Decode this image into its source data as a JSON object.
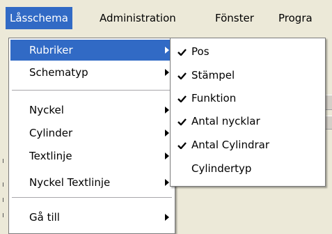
{
  "menubar": {
    "items": [
      {
        "label": "Låsschema"
      },
      {
        "label": "Administration"
      },
      {
        "label": "Fönster"
      },
      {
        "label": "Progra"
      }
    ]
  },
  "main_menu": {
    "items": [
      {
        "label": "Rubriker",
        "has_submenu": true,
        "highlighted": true
      },
      {
        "label": "Schematyp",
        "has_submenu": true
      },
      {
        "label": "Nyckel",
        "has_submenu": true
      },
      {
        "label": "Cylinder",
        "has_submenu": true
      },
      {
        "label": "Textlinje",
        "has_submenu": true
      },
      {
        "label": "Nyckel Textlinje",
        "has_submenu": true
      },
      {
        "label": "Gå till",
        "has_submenu": true
      }
    ]
  },
  "submenu": {
    "items": [
      {
        "label": "Pos",
        "checked": true
      },
      {
        "label": "Stämpel",
        "checked": true
      },
      {
        "label": "Funktion",
        "checked": true
      },
      {
        "label": "Antal nycklar",
        "checked": true
      },
      {
        "label": "Antal Cylindrar",
        "checked": true
      },
      {
        "label": "Cylindertyp",
        "checked": false
      }
    ]
  },
  "colors": {
    "highlight": "#316ac5",
    "menu_background": "#ffffff",
    "bar_background": "#ece9d8"
  }
}
